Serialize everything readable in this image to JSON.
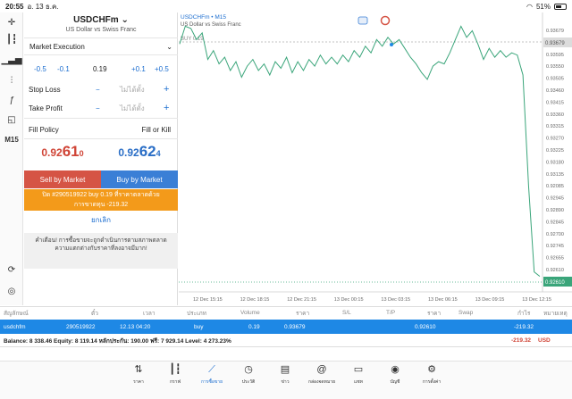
{
  "status": {
    "time": "20:55",
    "date": "อ. 13 ธ.ค.",
    "battery": "51%"
  },
  "left_toolbar": {
    "timeframe": "M15"
  },
  "order": {
    "symbol": "USDCHFm",
    "description": "US Dollar vs Swiss Franc",
    "execution": "Market Execution",
    "volume_steps": [
      "-0.5",
      "-0.1",
      "0.19",
      "+0.1",
      "+0.5"
    ],
    "stop_loss_label": "Stop Loss",
    "take_profit_label": "Take Profit",
    "unset_placeholder": "ไม่ได้ตั้ง",
    "minus": "−",
    "plus": "+",
    "fill_policy_label": "Fill Policy",
    "fill_policy_value": "Fill or Kill",
    "bid_main": "0.92",
    "bid_big": "61",
    "bid_sup": "0",
    "ask_main": "0.92",
    "ask_big": "62",
    "ask_sup": "4",
    "sell_label": "Sell by Market",
    "buy_label": "Buy by Market",
    "close_label_line1": "ปิด #290519922 buy 0.19 ที่ราคาตลาดด้วย",
    "close_label_line2": "การขาดทุน -219.32",
    "cancel_label": "ยกเลิก",
    "warning": "คำเตือน! การซื้อขายจะถูกดำเนินการตามสภาพตลาด ความแตกต่างกับราคาที่ลงอาจมีมาก!"
  },
  "chart": {
    "symbol_tf": "USDCHFm • M15",
    "description": "US Dollar vs Swiss Franc",
    "buy_line_label": "BUY 0.19",
    "price_labels": [
      "0.93679",
      "0.93635",
      "0.93595",
      "0.93550",
      "0.93505",
      "0.93460",
      "0.93415",
      "0.93360",
      "0.93315",
      "0.93270",
      "0.93225",
      "0.93180",
      "0.93135",
      "0.92085",
      "0.92945",
      "0.92890",
      "0.92845",
      "0.92700",
      "0.92745",
      "0.92655",
      "0.92610",
      "0.92565"
    ],
    "time_labels": [
      "12 Dec 15:15",
      "12 Dec 18:15",
      "12 Dec 21:15",
      "13 Dec 00:15",
      "13 Dec 03:15",
      "13 Dec 06:15",
      "13 Dec 09:15",
      "13 Dec 12:15"
    ],
    "current_price": "0.92610",
    "entry_price": "0.93679",
    "line_color": "#3aa57a"
  },
  "chart_data": {
    "type": "line",
    "title": "USDCHFm • M15",
    "x": [
      "12 Dec 15:15",
      "12 Dec 18:15",
      "12 Dec 21:15",
      "13 Dec 00:15",
      "13 Dec 03:15",
      "13 Dec 06:15",
      "13 Dec 09:15",
      "13 Dec 12:15"
    ],
    "y": [
      0.9371,
      0.9356,
      0.9357,
      0.9361,
      0.9361,
      0.9358,
      0.936,
      0.9261
    ],
    "ylim": [
      0.9254,
      0.9375
    ],
    "buy_level": 0.93679,
    "current_level": 0.9261
  },
  "trades": {
    "headers": [
      "สัญลักษณ์",
      "ตั๋ว",
      "เวลา",
      "ประเภท",
      "Volume",
      "ราคา",
      "S/L",
      "T/P",
      "ราคา",
      "Swap",
      "กำไร",
      "หมายเหตุ"
    ],
    "row": {
      "symbol": "usdchfm",
      "ticket": "290519922",
      "time": "12.13 04:20",
      "type": "buy",
      "volume": "0.19",
      "price": "0.93679",
      "sl": "",
      "tp": "",
      "current": "0.92610",
      "swap": "",
      "profit": "-219.32"
    },
    "balance_text": "Balance: 8 338.46 Equity: 8 119.14 หลักประกัน: 190.00 ฟรี: 7 929.14 Level: 4 273.23%",
    "total_profit": "-219.32",
    "currency": "USD"
  },
  "nav": [
    {
      "label": "ราคา",
      "icon": "quotes-icon"
    },
    {
      "label": "กราฟ",
      "icon": "chart-icon"
    },
    {
      "label": "การซื้อขาย",
      "icon": "trade-icon"
    },
    {
      "label": "ประวัติ",
      "icon": "history-icon"
    },
    {
      "label": "ข่าว",
      "icon": "news-icon"
    },
    {
      "label": "กล่องจดหมาย",
      "icon": "mail-icon"
    },
    {
      "label": "แชท",
      "icon": "chat-icon"
    },
    {
      "label": "บัญชี",
      "icon": "account-icon"
    },
    {
      "label": "การตั้งค่า",
      "icon": "settings-icon"
    }
  ]
}
